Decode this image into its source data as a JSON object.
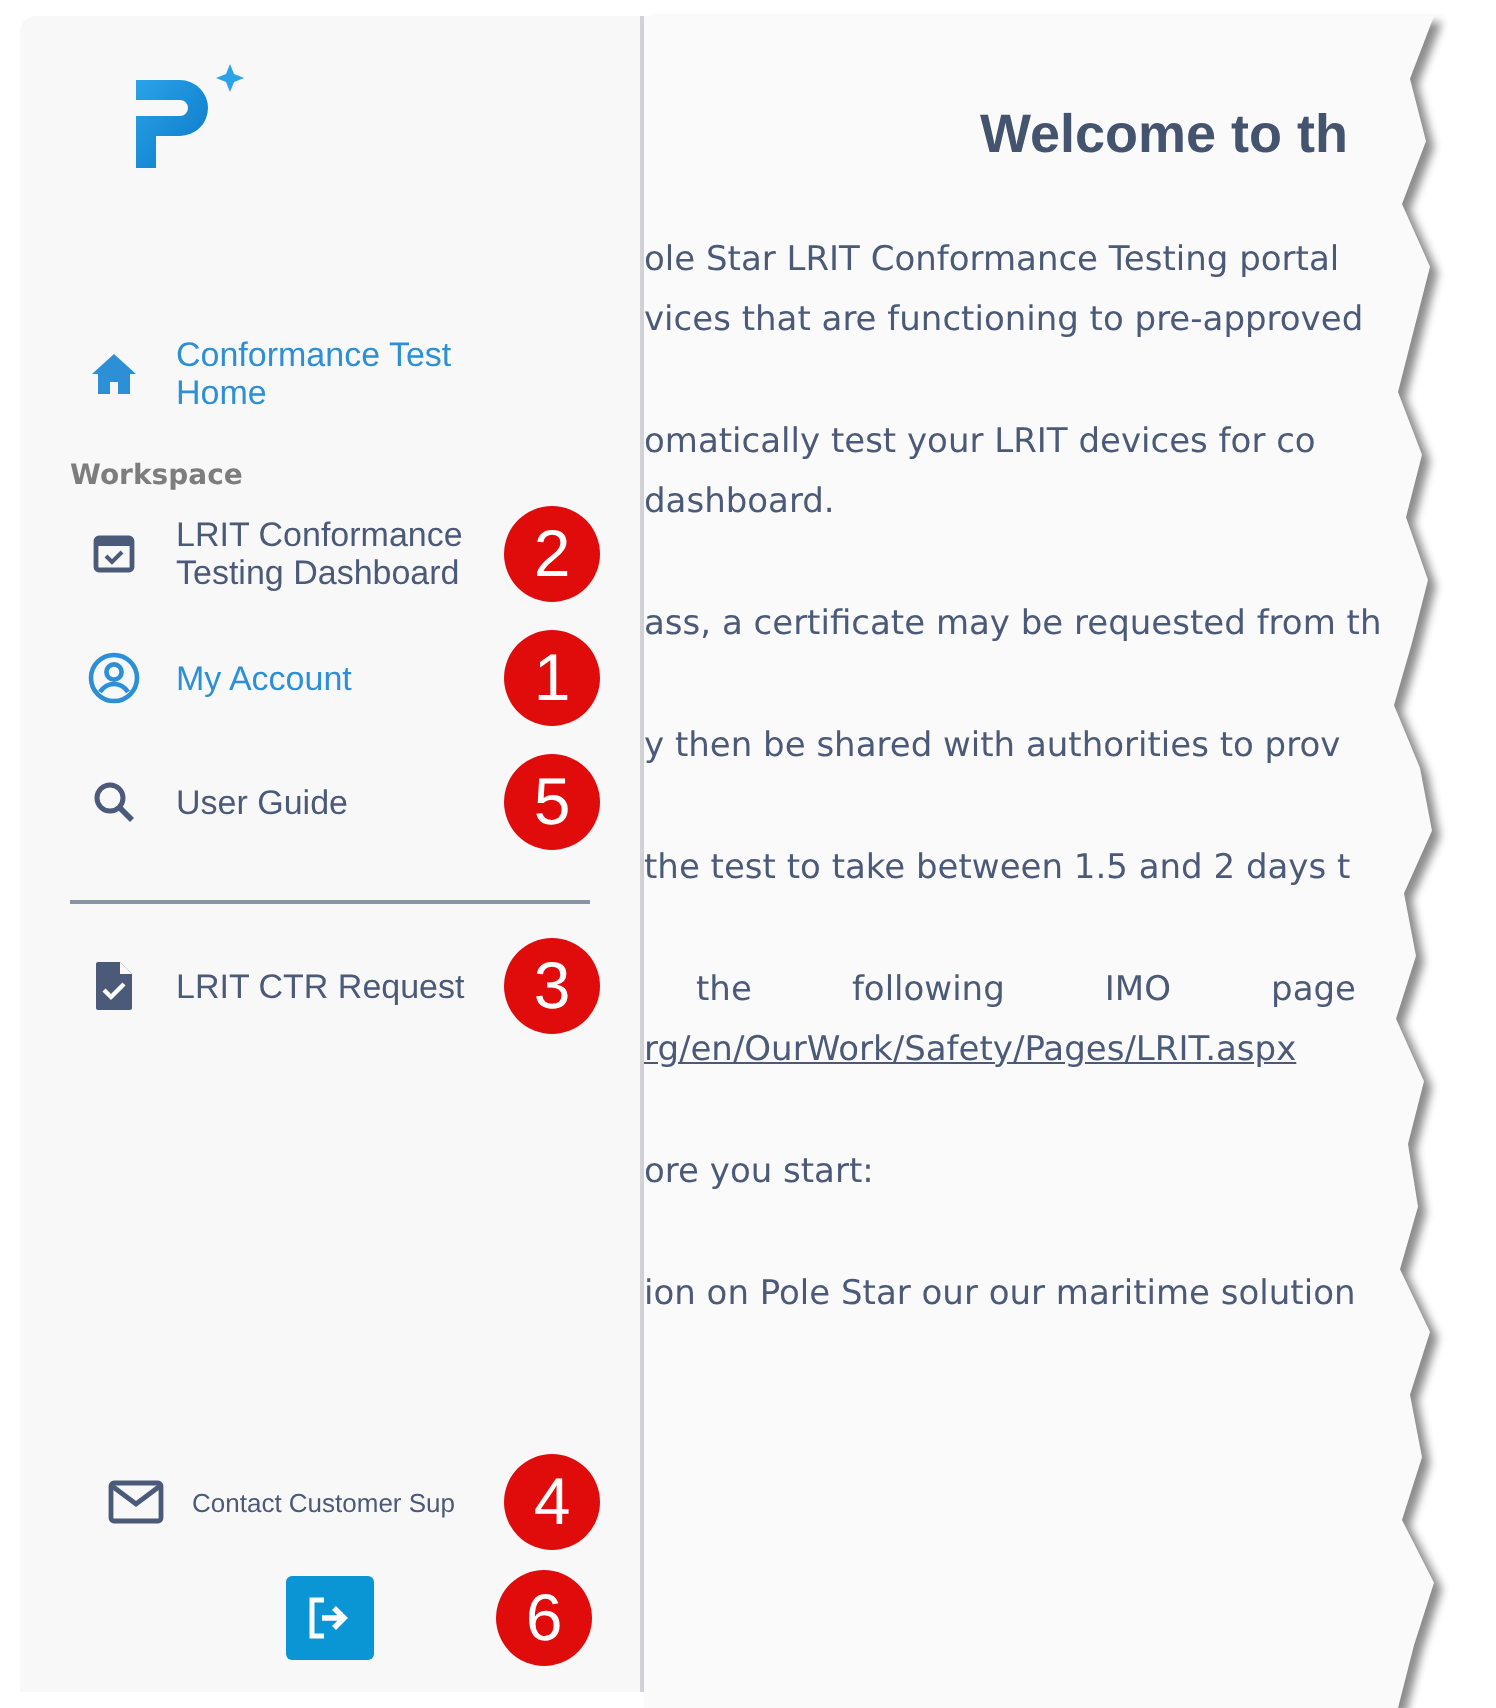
{
  "sidebar": {
    "home": {
      "label": "Conformance Test Home",
      "active": true
    },
    "section_label": "Workspace",
    "items": [
      {
        "label": "LRIT Conformance Testing Dashboard",
        "active": false,
        "callout": "2"
      },
      {
        "label": "My Account",
        "active": true,
        "callout": "1"
      },
      {
        "label": "User Guide",
        "active": false,
        "callout": "5"
      }
    ],
    "lower_items": [
      {
        "label": "LRIT CTR Request",
        "active": false,
        "callout": "3"
      }
    ],
    "contact": {
      "label": "Contact Customer Sup",
      "callout": "4"
    },
    "logout": {
      "callout": "6"
    }
  },
  "content": {
    "title": "Welcome to th",
    "paragraphs": [
      {
        "lines": [
          "ole Star LRIT Conformance Testing portal",
          "vices that are functioning to pre-approved"
        ]
      },
      {
        "lines": [
          "omatically test your LRIT devices for co",
          "dashboard."
        ]
      },
      {
        "lines": [
          "ass, a certificate may be requested from th"
        ]
      },
      {
        "lines": [
          "y then be shared with authorities to prov"
        ]
      },
      {
        "lines": [
          "the test to take between 1.5 and 2 days t"
        ]
      },
      {
        "lines": [
          "the following IMO page"
        ],
        "link": "rg/en/OurWork/Safety/Pages/LRIT.aspx"
      },
      {
        "lines": [
          "ore you start:"
        ]
      },
      {
        "lines": [
          "ion on Pole Star our our maritime solution"
        ]
      }
    ]
  }
}
